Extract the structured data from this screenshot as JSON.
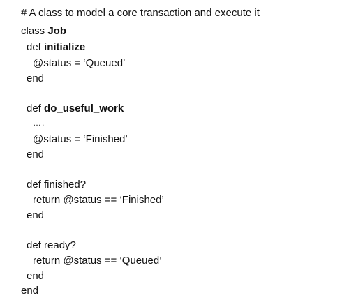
{
  "code": {
    "comment": "# A class to model a core transaction and execute it",
    "class_kw": "class ",
    "class_name": "Job",
    "def1_kw": "def ",
    "def1_name": "initialize",
    "def1_body": "@status = ‘Queued’",
    "def1_end": "end",
    "def2_kw": "def ",
    "def2_name": "do_useful_work",
    "def2_dots": "….",
    "def2_body": "@status = ‘Finished’",
    "def2_end": "end",
    "def3_sig": "def finished?",
    "def3_body": "return @status == ‘Finished’",
    "def3_end": "end",
    "def4_sig": "def ready?",
    "def4_body": "return @status == ‘Queued’",
    "def4_end": "end",
    "class_end": "end"
  }
}
